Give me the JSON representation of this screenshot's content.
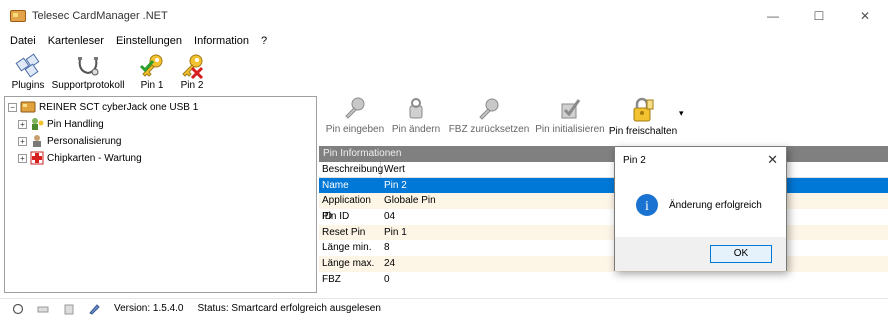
{
  "window": {
    "title": "Telesec CardManager .NET",
    "minimize_symbol": "—",
    "maximize_symbol": "☐",
    "close_symbol": "✕"
  },
  "menu": [
    "Datei",
    "Kartenleser",
    "Einstellungen",
    "Information",
    "?"
  ],
  "toolbar": {
    "buttons": [
      {
        "label": "Plugins",
        "icon": "plugins-icon"
      },
      {
        "label": "Supportprotokoll",
        "icon": "stethoscope-icon"
      },
      {
        "label": "Pin 1",
        "icon": "key-check-icon"
      },
      {
        "label": "Pin 2",
        "icon": "key-x-icon"
      }
    ]
  },
  "tree": {
    "root": "REINER SCT cyberJack one USB 1",
    "children": [
      "Pin Handling",
      "Personalisierung",
      "Chipkarten - Wartung"
    ]
  },
  "pin_toolbar": {
    "buttons": [
      {
        "label": "Pin eingeben",
        "enabled": false
      },
      {
        "label": "Pin ändern",
        "enabled": false
      },
      {
        "label": "FBZ zurücksetzen",
        "enabled": false
      },
      {
        "label": "Pin initialisieren",
        "enabled": false
      },
      {
        "label": "Pin freischalten",
        "enabled": true
      }
    ],
    "dropdown_glyph": "▾"
  },
  "pin_info": {
    "header": "Pin Informationen",
    "columns": [
      "Beschreibung",
      "Wert"
    ],
    "rows": [
      {
        "label": "Name",
        "value": "Pin 2"
      },
      {
        "label": "Application ID",
        "value": "Globale Pin"
      },
      {
        "label": "Pin ID",
        "value": "04"
      },
      {
        "label": "Reset Pin",
        "value": "Pin 1"
      },
      {
        "label": "Länge min.",
        "value": "8"
      },
      {
        "label": "Länge max.",
        "value": "24"
      },
      {
        "label": "FBZ",
        "value": "0"
      }
    ],
    "selected_row": 0
  },
  "status": {
    "version": "Version: 1.5.4.0",
    "message": "Status: Smartcard erfolgreich ausgelesen"
  },
  "dialog": {
    "title": "Pin 2",
    "message": "Änderung erfolgreich",
    "ok_label": "OK",
    "close_symbol": "✕",
    "info_glyph": "i"
  },
  "colors": {
    "selection": "#0078d7",
    "row_alt": "#fdf5e6",
    "section_header": "#808080"
  }
}
